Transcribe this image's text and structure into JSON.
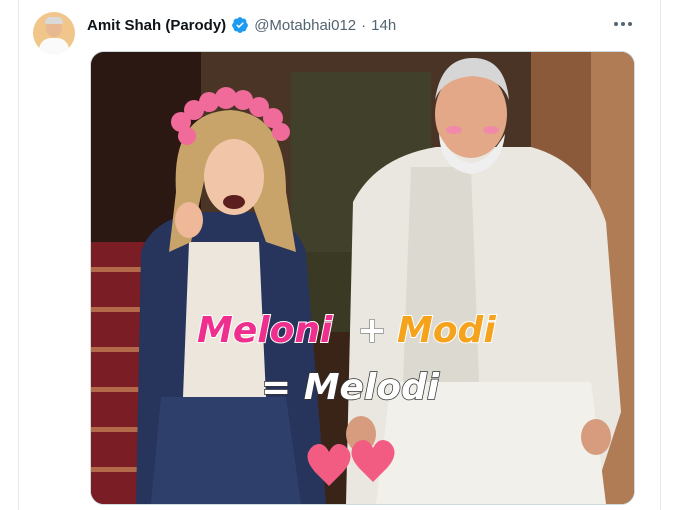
{
  "tweet": {
    "display_name": "Amit Shah (Parody)",
    "handle": "@Motabhai012",
    "separator": "·",
    "time": "14h"
  },
  "icons": {
    "verified": "verified-badge-icon",
    "more": "more-options-icon"
  },
  "media": {
    "caption_word_1": "Meloni",
    "caption_plus": "+",
    "caption_word_2": "Modi",
    "caption_result": "= Melodi"
  },
  "colors": {
    "verified_blue": "#1d9bf0",
    "caption_pink": "#ee2f8d",
    "caption_orange": "#f5a21c",
    "heart_pink": "#f25c82"
  }
}
